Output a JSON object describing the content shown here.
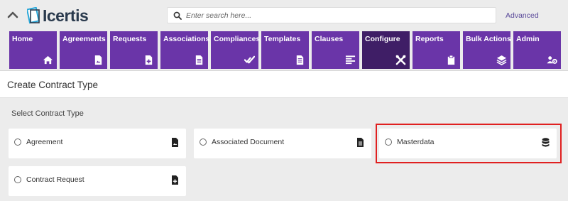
{
  "header": {
    "logo_text": "Icertis",
    "search_placeholder": "Enter search here...",
    "advanced_label": "Advanced"
  },
  "nav": [
    {
      "label": "Home",
      "icon": "home-icon"
    },
    {
      "label": "Agreements",
      "icon": "document-image-icon"
    },
    {
      "label": "Requests",
      "icon": "document-plus-icon"
    },
    {
      "label": "Associations",
      "icon": "document-icon"
    },
    {
      "label": "Compliances",
      "icon": "double-check-icon"
    },
    {
      "label": "Templates",
      "icon": "document-lines-icon"
    },
    {
      "label": "Clauses",
      "icon": "align-left-icon"
    },
    {
      "label": "Configure",
      "icon": "tools-icon"
    },
    {
      "label": "Reports",
      "icon": "clipboard-icon"
    },
    {
      "label": "Bulk Actions",
      "icon": "layers-icon"
    },
    {
      "label": "Admin",
      "icon": "users-gear-icon"
    }
  ],
  "colors": {
    "tile": "#6a35a8",
    "tile_active": "#3f1e66",
    "highlight": "#e02020"
  },
  "page": {
    "title": "Create Contract Type",
    "section_label": "Select Contract Type"
  },
  "contract_types": [
    {
      "label": "Agreement",
      "icon": "document-image-icon"
    },
    {
      "label": "Associated Document",
      "icon": "document-icon"
    },
    {
      "label": "Masterdata",
      "icon": "database-icon"
    },
    {
      "label": "Contract Request",
      "icon": "document-plus-icon"
    }
  ]
}
